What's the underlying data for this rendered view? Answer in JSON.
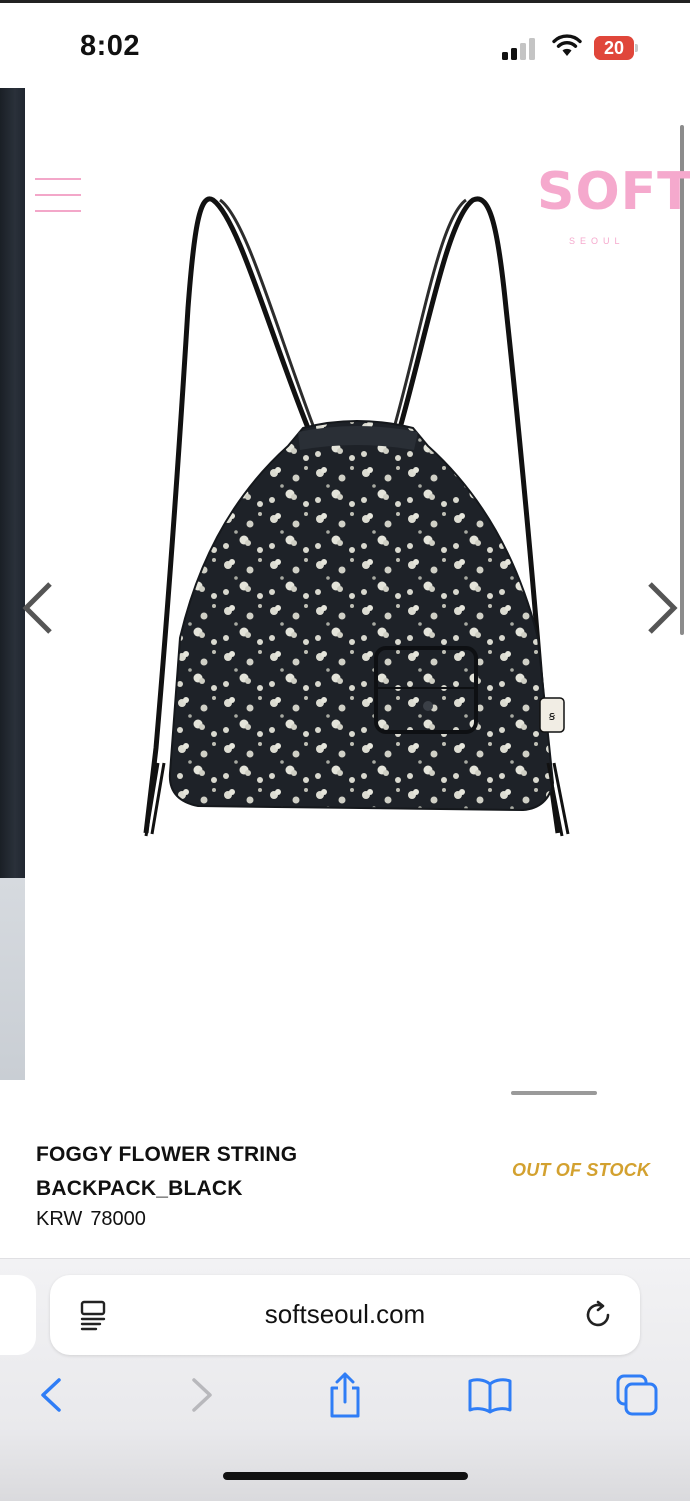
{
  "status_bar": {
    "time": "8:02",
    "battery_level": "20",
    "battery_color": "#e0463a",
    "signal_bars": 2
  },
  "site": {
    "logo_main": "SOFT",
    "logo_sub": "SEOUL",
    "brand_color": "#f5a9cd"
  },
  "carousel": {
    "prev_icon": "chevron-left-icon",
    "next_icon": "chevron-right-icon"
  },
  "product": {
    "name_line1": "FOGGY FLOWER STRING",
    "name_line2": "BACKPACK_BLACK",
    "currency": "KRW",
    "price": "78000",
    "stock_status": "OUT OF STOCK",
    "stock_color": "#d3a12f"
  },
  "browser": {
    "url": "softseoul.com",
    "icons": [
      "reader-icon",
      "reload-icon",
      "back-icon",
      "forward-icon",
      "share-icon",
      "bookmarks-icon",
      "tabs-icon"
    ]
  }
}
